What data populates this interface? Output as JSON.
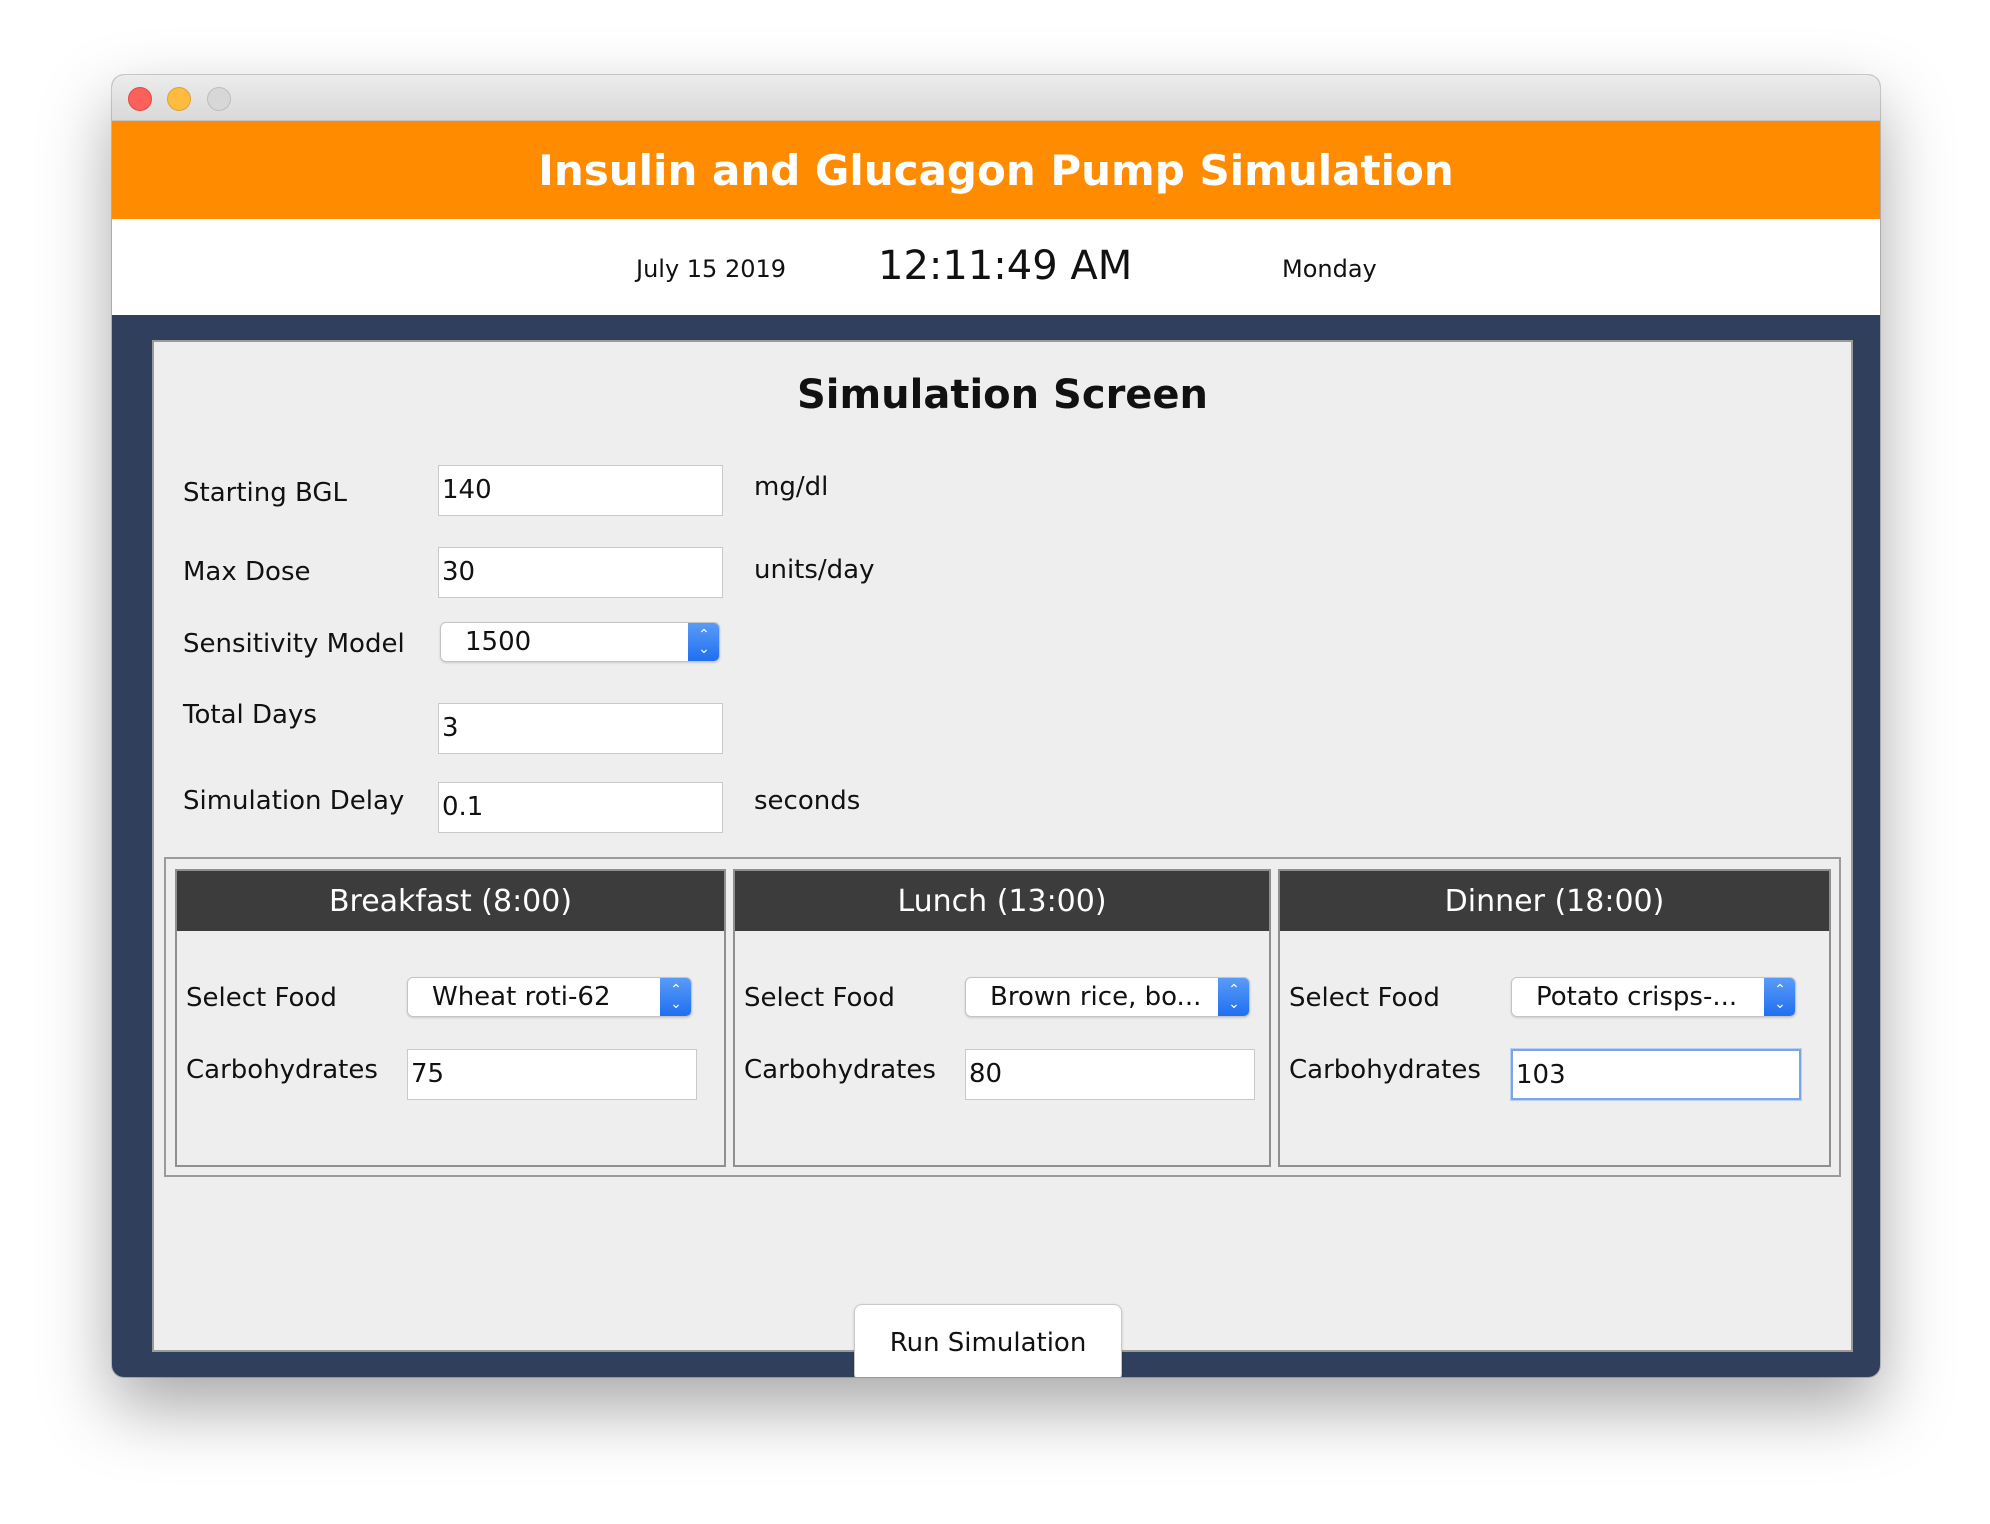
{
  "window": {
    "title": ""
  },
  "banner": {
    "title": "Insulin and Glucagon Pump Simulation",
    "color": "#ff8c00"
  },
  "datebar": {
    "date": "July 15 2019",
    "time": "12:11:49 AM",
    "day": "Monday"
  },
  "screen": {
    "title": "Simulation Screen",
    "fields": {
      "starting_bgl": {
        "label": "Starting BGL",
        "value": "140",
        "unit": "mg/dl"
      },
      "max_dose": {
        "label": "Max Dose",
        "value": "30",
        "unit": "units/day"
      },
      "sensitivity_model": {
        "label": "Sensitivity Model",
        "value": "1500"
      },
      "total_days": {
        "label": "Total Days",
        "value": "3"
      },
      "simulation_delay": {
        "label": "Simulation Delay",
        "value": "0.1",
        "unit": "seconds"
      }
    },
    "meals": [
      {
        "title": "Breakfast (8:00)",
        "food_label": "Select Food",
        "food": "Wheat roti-62",
        "carbs_label": "Carbohydrates",
        "carbs": "75"
      },
      {
        "title": "Lunch (13:00)",
        "food_label": "Select Food",
        "food": "Brown rice, bo...",
        "carbs_label": "Carbohydrates",
        "carbs": "80"
      },
      {
        "title": "Dinner (18:00)",
        "food_label": "Select Food",
        "food": "Potato crisps-...",
        "carbs_label": "Carbohydrates",
        "carbs": "103"
      }
    ],
    "run_button": "Run Simulation"
  },
  "colors": {
    "frame": "#2f3f5c",
    "panel": "#eeeeee",
    "meal_header": "#3c3c3c",
    "select_accent": "#1f6ef0"
  },
  "icons": {
    "select_arrows": "chevron-up-down-icon"
  }
}
